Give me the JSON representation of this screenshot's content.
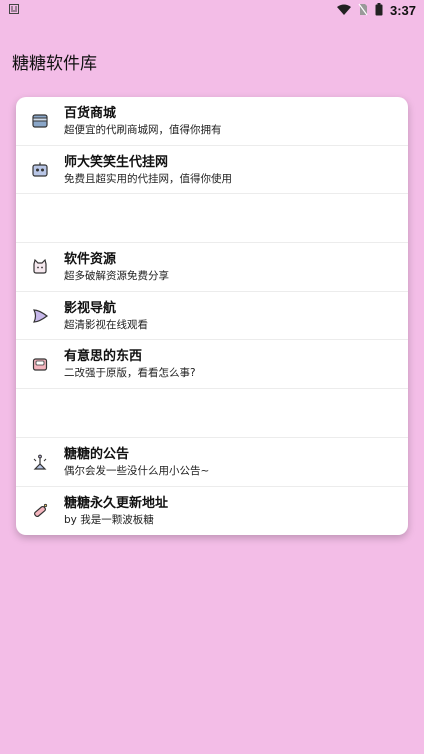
{
  "status_bar": {
    "left_icon": "debug-icon",
    "time": "3:37",
    "icons": [
      "wifi-icon",
      "no-sim-icon",
      "battery-icon"
    ]
  },
  "app": {
    "title": "糖糖软件库"
  },
  "menu": {
    "items": [
      {
        "title": "百货商城",
        "subtitle": "超便宜的代刷商城网，值得你拥有",
        "icon": "store-icon"
      },
      {
        "title": "师大笑笑生代挂网",
        "subtitle": "免费且超实用的代挂网，值得你使用",
        "icon": "robot-icon"
      },
      {
        "title": "软件资源",
        "subtitle": "超多破解资源免费分享",
        "icon": "cat-icon"
      },
      {
        "title": "影视导航",
        "subtitle": "超清影视在线观看",
        "icon": "play-icon"
      },
      {
        "title": "有意思的东西",
        "subtitle": "二改强于原版，看看怎么事?",
        "icon": "gift-icon"
      },
      {
        "title": "糖糖的公告",
        "subtitle": "偶尔会发一些没什么用小公告~",
        "icon": "announcement-icon"
      },
      {
        "title": "糖糖永久更新地址",
        "subtitle": "by 我是一颗波板糖",
        "icon": "candy-icon"
      }
    ]
  }
}
